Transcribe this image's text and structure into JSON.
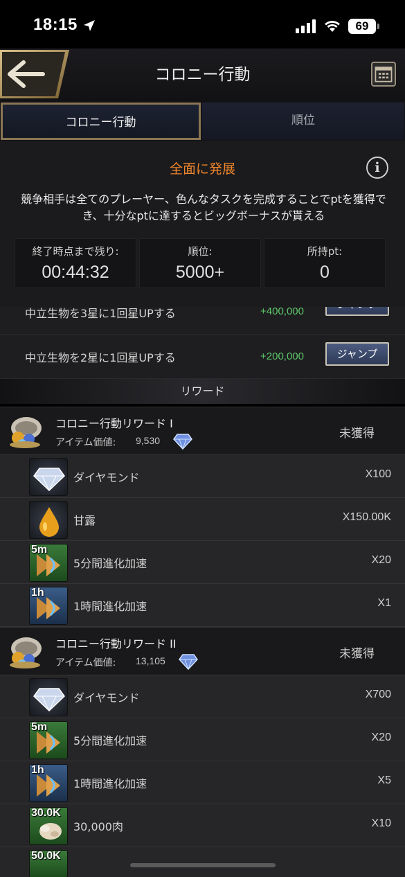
{
  "status_bar": {
    "time": "18:15",
    "battery": "69"
  },
  "header": {
    "title": "コロニー行動"
  },
  "tabs": [
    {
      "label": "コロニー行動"
    },
    {
      "label": "順位"
    }
  ],
  "event": {
    "title": "全面に発展",
    "description": "競争相手は全てのプレーヤー、色んなタスクを完成することでptを獲得でき、十分なptに達するとビッグボーナスが貰える",
    "stats": [
      {
        "label": "終了時点まで残り:",
        "value": "00:44:32"
      },
      {
        "label": "順位:",
        "value": "5000+"
      },
      {
        "label": "所持pt:",
        "value": "0"
      }
    ]
  },
  "tasks": [
    {
      "label": "中立生物を3星に1回星UPする",
      "points": "+400,000",
      "button": "ジャンプ"
    },
    {
      "label": "中立生物を2星に1回星UPする",
      "points": "+200,000",
      "button": "ジャンプ"
    }
  ],
  "rewards_header": "リワード",
  "reward_groups": [
    {
      "name": "コロニー行動リワード I",
      "value_label": "アイテム価値:",
      "value": "9,530",
      "status": "未獲得",
      "items": [
        {
          "name": "ダイヤモンド",
          "qty": "X100",
          "icon": "diamond-icon"
        },
        {
          "name": "甘露",
          "qty": "X150.00K",
          "icon": "nectar-drop-icon"
        },
        {
          "name": "5分間進化加速",
          "qty": "X20",
          "icon": "evolution-speedup-5m-icon",
          "tag": "5m"
        },
        {
          "name": "1時間進化加速",
          "qty": "X1",
          "icon": "evolution-speedup-1h-icon",
          "tag": "1h"
        }
      ]
    },
    {
      "name": "コロニー行動リワード II",
      "value_label": "アイテム価値:",
      "value": "13,105",
      "status": "未獲得",
      "items": [
        {
          "name": "ダイヤモンド",
          "qty": "X700",
          "icon": "diamond-icon"
        },
        {
          "name": "5分間進化加速",
          "qty": "X20",
          "icon": "evolution-speedup-5m-icon",
          "tag": "5m"
        },
        {
          "name": "1時間進化加速",
          "qty": "X5",
          "icon": "evolution-speedup-1h-icon",
          "tag": "1h"
        },
        {
          "name": "30,000肉",
          "qty": "X10",
          "icon": "meat-icon",
          "tag": "30.0K"
        },
        {
          "name": "",
          "qty": "",
          "icon": "meat-icon",
          "tag": "50.0K"
        }
      ]
    }
  ],
  "colors": {
    "accent_orange": "#f0862c",
    "points_green": "#5cc66a",
    "tab_border": "#8a7654"
  }
}
